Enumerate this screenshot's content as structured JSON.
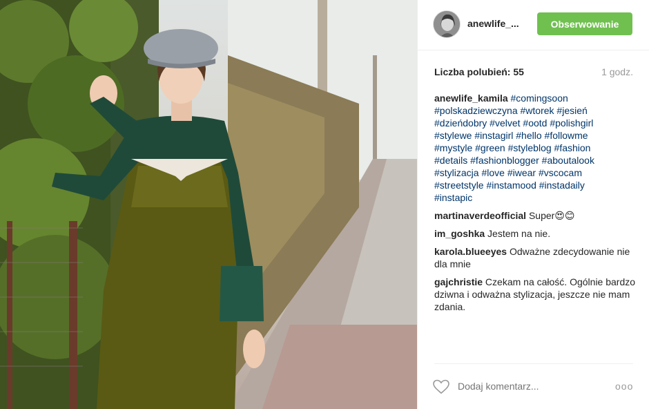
{
  "post": {
    "username": "anewlife_...",
    "follow_label": "Obserwowanie",
    "likes_label": "Liczba polubień:",
    "likes_count": "55",
    "time": "1 godz."
  },
  "caption": {
    "user": "anewlife_kamila",
    "lines": [
      "#comingsoon",
      "#polskadziewczyna #wtorek #jesień",
      "#dzieńdobry #velvet #ootd #polishgirl",
      "#stylewe #instagirl #hello #followme",
      "#mystyle #green #styleblog #fashion",
      "#details #fashionblogger #aboutalook",
      "#stylizacja #love #iwear #vscocam",
      "#streetstyle #instamood #instadaily",
      "#instapic"
    ]
  },
  "comments": [
    {
      "user": "martinaverdeofficial",
      "text": "Super😍😊"
    },
    {
      "user": "im_goshka",
      "text": "Jestem na nie."
    },
    {
      "user": "karola.blueeyes",
      "text": "Odważne zdecydowanie nie dla mnie"
    },
    {
      "user": "gajchristie",
      "text": "Czekam na całość. Ogólnie bardzo dziwna i odważna stylizacja, jeszcze nie mam zdania."
    }
  ],
  "footer": {
    "add_comment_placeholder": "Dodaj komentarz...",
    "more_label": "ooo",
    "like_icon": "heart-icon"
  },
  "colors": {
    "follow_button": "#70c050",
    "hashtag": "#003569",
    "muted": "#999999"
  }
}
